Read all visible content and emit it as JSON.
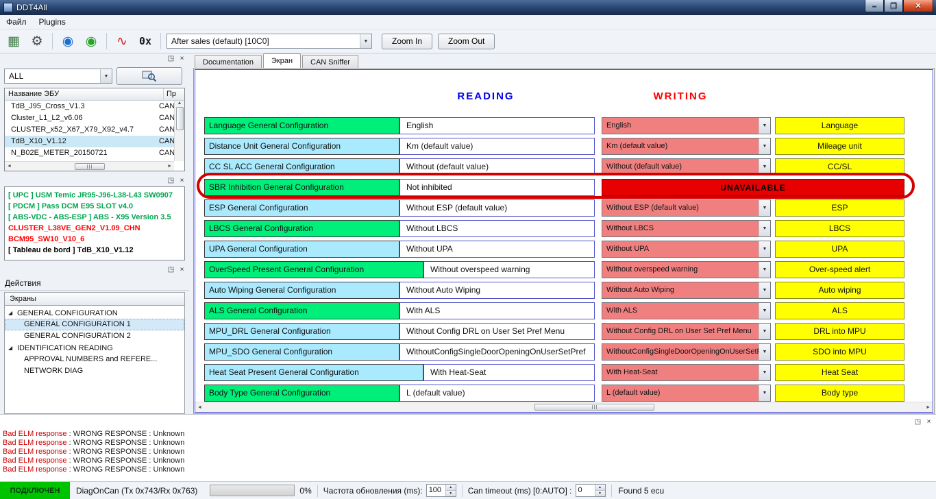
{
  "window": {
    "title": "DDT4All"
  },
  "menu": {
    "items": [
      {
        "label": "Файл"
      },
      {
        "label": "Plugins"
      }
    ]
  },
  "toolbar": {
    "icons": [
      {
        "name": "expert-mode-icon",
        "glyph": "▦",
        "color": "#3f7d46"
      },
      {
        "name": "settings-gears-icon",
        "glyph": "⚙",
        "color": "#4a4a4a"
      },
      {
        "name": "web-source-icon",
        "glyph": "◉",
        "color": "#1a6fd4"
      },
      {
        "name": "connect-icon",
        "glyph": "◉",
        "color": "#27a327"
      },
      {
        "name": "ecu-scan-icon",
        "glyph": "∿",
        "color": "#d42222"
      },
      {
        "name": "hex-mode-icon",
        "glyph": "0x",
        "color": "#1a1a1a"
      }
    ],
    "screen_selector": {
      "value": "After sales (default) [10C0]"
    },
    "zoom_in_label": "Zoom In",
    "zoom_out_label": "Zoom Out"
  },
  "sidebar": {
    "filter": {
      "value": "ALL"
    },
    "ecu_list": {
      "headers": [
        "Название ЭБУ",
        "Пр"
      ],
      "rows": [
        {
          "name": "TdB_J95_Cross_V1.3",
          "protocol": "CAN",
          "selected": false
        },
        {
          "name": "Cluster_L1_L2_v6.06",
          "protocol": "CAN",
          "selected": false
        },
        {
          "name": "CLUSTER_x52_X67_X79_X92_v4.7",
          "protocol": "CAN",
          "selected": false
        },
        {
          "name": "TdB_X10_V1.12",
          "protocol": "CAN",
          "selected": true
        },
        {
          "name": "N_B02E_METER_20150721",
          "protocol": "CAN",
          "selected": false
        }
      ]
    },
    "ecu_info": [
      {
        "text": "[ UPC ] USM Temic JR95-J96-L38-L43 SW0907",
        "color": "#00a651"
      },
      {
        "text": "[ PDCM ] Pass DCM E95 SLOT v4.0",
        "color": "#00a651"
      },
      {
        "text": "[ ABS-VDC - ABS-ESP ] ABS - X95 Version 3.5",
        "color": "#00a651"
      },
      {
        "text": "CLUSTER_L38VE_GEN2_V1.09_CHN",
        "color": "#ff0000"
      },
      {
        "text": "BCM95_SW10_V10_6",
        "color": "#ff0000"
      },
      {
        "text": "[ Tableau de bord ] TdB_X10_V1.12",
        "color": "#000000"
      }
    ],
    "actions_title": "Действия",
    "screens_title": "Экраны",
    "screens_tree": [
      {
        "label": "GENERAL CONFIGURATION",
        "expanded": true,
        "children": [
          {
            "label": "GENERAL CONFIGURATION 1",
            "selected": true
          },
          {
            "label": "GENERAL CONFIGURATION 2",
            "selected": false
          }
        ]
      },
      {
        "label": "IDENTIFICATION READING",
        "expanded": true,
        "children": [
          {
            "label": "APPROVAL NUMBERS and REFERE...",
            "selected": false
          },
          {
            "label": "NETWORK DIAG",
            "selected": false
          }
        ]
      }
    ]
  },
  "tabs": [
    {
      "label": "Documentation",
      "active": false
    },
    {
      "label": "Экран",
      "active": true
    },
    {
      "label": "CAN Sniffer",
      "active": false
    }
  ],
  "screen": {
    "reading_header": "READING",
    "writing_header": "WRITING",
    "rows": [
      {
        "label": "Language General Configuration",
        "color": "green",
        "reading": "English",
        "writing": "English",
        "button": "Language"
      },
      {
        "label": "Distance Unit General Configuration",
        "color": "cyan",
        "reading": "Km (default value)",
        "writing": "Km (default value)",
        "button": "Mileage unit"
      },
      {
        "label": "CC SL ACC General Configuration",
        "color": "cyan",
        "reading": "Without (default value)",
        "writing": "Without (default value)",
        "button": "CC/SL"
      },
      {
        "label": "SBR Inhibition General Configuration",
        "color": "green",
        "reading": "Not inhibited",
        "writing": "UNAVAILABLE",
        "unavailable": true,
        "highlighted": true
      },
      {
        "label": "ESP General Configuration",
        "color": "cyan",
        "reading": "Without ESP (default value)",
        "writing": "Without ESP (default value)",
        "button": "ESP"
      },
      {
        "label": "LBCS General Configuration",
        "color": "green",
        "reading": "Without LBCS",
        "writing": "Without LBCS",
        "button": "LBCS"
      },
      {
        "label": "UPA General Configuration",
        "color": "cyan",
        "reading": "Without UPA",
        "writing": "Without UPA",
        "button": "UPA"
      },
      {
        "label": "OverSpeed Present General Configuration",
        "color": "green",
        "wide": true,
        "reading": "Without overspeed warning",
        "writing": "Without overspeed warning",
        "button": "Over-speed alert"
      },
      {
        "label": "Auto Wiping General Configuration",
        "color": "cyan",
        "reading": "Without Auto Wiping",
        "writing": "Without Auto Wiping",
        "button": "Auto wiping"
      },
      {
        "label": "ALS General Configuration",
        "color": "green",
        "reading": "With ALS",
        "writing": "With ALS",
        "button": "ALS"
      },
      {
        "label": "MPU_DRL General Configuration",
        "color": "cyan",
        "reading": "Without Config DRL on User Set Pref Menu",
        "writing": "Without Config DRL on User Set Pref Menu",
        "button": "DRL into MPU"
      },
      {
        "label": "MPU_SDO General Configuration",
        "color": "cyan",
        "reading": "WithoutConfigSingleDoorOpeningOnUserSetPref",
        "writing": "WithoutConfigSingleDoorOpeningOnUserSetPre",
        "button": "SDO into MPU"
      },
      {
        "label": "Heat Seat Present General Configuration",
        "color": "cyan",
        "wide": true,
        "reading": "With Heat-Seat",
        "writing": "With Heat-Seat",
        "button": "Heat Seat"
      },
      {
        "label": "Body Type General Configuration",
        "color": "green",
        "reading": "L (default value)",
        "writing": "L (default value)",
        "button": "Body type"
      }
    ]
  },
  "console": {
    "lines": [
      {
        "prefix": "Bad ELM response",
        "rest": " : WRONG RESPONSE : Unknown"
      },
      {
        "prefix": "Bad ELM response",
        "rest": " : WRONG RESPONSE : Unknown"
      },
      {
        "prefix": "Bad ELM response",
        "rest": " : WRONG RESPONSE : Unknown"
      },
      {
        "prefix": "Bad ELM response",
        "rest": " : WRONG RESPONSE : Unknown"
      },
      {
        "prefix": "Bad ELM response",
        "rest": " : WRONG RESPONSE : Unknown"
      }
    ]
  },
  "statusbar": {
    "connection": "ПОДКЛЮЧЕН",
    "protocol": "DiagOnCan (Tx 0x743/Rx 0x763)",
    "progress": "0%",
    "refresh_label": "Частота обновления (ms):",
    "refresh_value": "100",
    "timeout_label": "Can timeout (ms) [0:AUTO] :",
    "timeout_value": "0",
    "found": "Found 5 ecu"
  },
  "colors": {
    "label_green": "#00ee7a",
    "label_cyan": "#aaeaff",
    "combo_pink": "#f08080",
    "button_yellow": "#ffff00",
    "unavailable_red": "#e60000",
    "reading_header": "#0000ee",
    "writing_header": "#ff0000",
    "annotation": "#d40000",
    "connected_bg": "#00c300"
  }
}
